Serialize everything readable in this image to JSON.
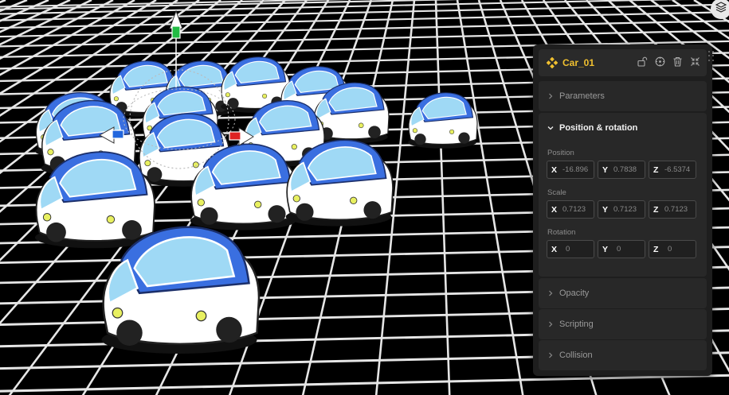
{
  "object": {
    "name": "Car_01",
    "icon": "component-diamond-icon",
    "accent": "#f0c030"
  },
  "header_tools": [
    "unlock-icon",
    "target-icon",
    "trash-icon",
    "collapse-icon"
  ],
  "layers_button": {
    "icon": "layers-icon"
  },
  "sections": {
    "parameters": {
      "label": "Parameters"
    },
    "position_rotation": {
      "label": "Position & rotation",
      "position": {
        "label": "Position",
        "x": "-16.896",
        "y": "0.7838",
        "z": "-6.5374"
      },
      "scale": {
        "label": "Scale",
        "x": "0.7123",
        "y": "0.7123",
        "z": "0.7123"
      },
      "rotation": {
        "label": "Rotation",
        "x": "0",
        "y": "0",
        "z": "0"
      },
      "axes": {
        "x": "X",
        "y": "Y",
        "z": "Z"
      }
    },
    "opacity": {
      "label": "Opacity"
    },
    "scripting": {
      "label": "Scripting"
    },
    "collision": {
      "label": "Collision"
    }
  },
  "scene": {
    "background": "#000000",
    "grid_color": "#e6e6e6",
    "car_body_color": "#ffffff",
    "car_accent_color": "#3a6fe0",
    "car_glass_color": "#9fd9f5",
    "gizmo_colors": {
      "y_axis": "#22bb44",
      "x_neg": "#2266dd",
      "z_axis": "#dd2222"
    }
  }
}
